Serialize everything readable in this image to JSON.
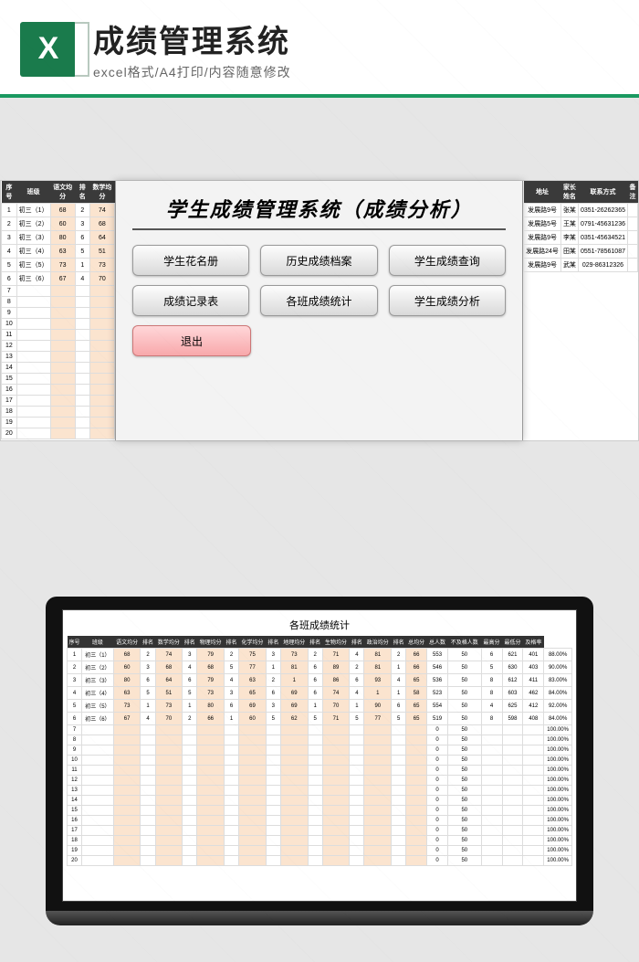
{
  "header": {
    "icon_letter": "X",
    "title": "成绩管理系统",
    "subtitle": "excel格式/A4打印/内容随意修改"
  },
  "panel": {
    "title": "学生成绩管理系统（成绩分析）",
    "buttons": [
      "学生花名册",
      "历史成绩档案",
      "学生成绩查询",
      "成绩记录表",
      "各班成绩统计",
      "学生成绩分析"
    ],
    "exit": "退出"
  },
  "left_grid": {
    "headers": [
      "序号",
      "班级",
      "语文均分",
      "排名",
      "数学均分"
    ],
    "rows": [
      [
        "1",
        "初三（1）",
        "68",
        "2",
        "74"
      ],
      [
        "2",
        "初三（2）",
        "60",
        "3",
        "68"
      ],
      [
        "3",
        "初三（3）",
        "80",
        "6",
        "64"
      ],
      [
        "4",
        "初三（4）",
        "63",
        "5",
        "51"
      ],
      [
        "5",
        "初三（5）",
        "73",
        "1",
        "73"
      ],
      [
        "6",
        "初三（6）",
        "67",
        "4",
        "70"
      ],
      [
        "7",
        "",
        "",
        "",
        ""
      ],
      [
        "8",
        "",
        "",
        "",
        ""
      ],
      [
        "9",
        "",
        "",
        "",
        ""
      ],
      [
        "10",
        "",
        "",
        "",
        ""
      ],
      [
        "11",
        "",
        "",
        "",
        ""
      ],
      [
        "12",
        "",
        "",
        "",
        ""
      ],
      [
        "13",
        "",
        "",
        "",
        ""
      ],
      [
        "14",
        "",
        "",
        "",
        ""
      ],
      [
        "15",
        "",
        "",
        "",
        ""
      ],
      [
        "16",
        "",
        "",
        "",
        ""
      ],
      [
        "17",
        "",
        "",
        "",
        ""
      ],
      [
        "18",
        "",
        "",
        "",
        ""
      ],
      [
        "19",
        "",
        "",
        "",
        ""
      ],
      [
        "20",
        "",
        "",
        "",
        ""
      ]
    ]
  },
  "right_grid": {
    "headers": [
      "地址",
      "家长姓名",
      "联系方式",
      "备注"
    ],
    "rows": [
      [
        "发展路9号",
        "张某",
        "0351-26262365",
        ""
      ],
      [
        "发展路5号",
        "王某",
        "0791-45631236",
        ""
      ],
      [
        "发展路9号",
        "李某",
        "0351-45634521",
        ""
      ],
      [
        "发展路24号",
        "田某",
        "0551-78561087",
        ""
      ],
      [
        "发展路9号",
        "武某",
        "029-86312326",
        ""
      ]
    ]
  },
  "laptop": {
    "sheet_title": "各班成绩统计",
    "headers": [
      "序号",
      "班级",
      "语文均分",
      "排名",
      "数学均分",
      "排名",
      "物理均分",
      "排名",
      "化学均分",
      "排名",
      "地理均分",
      "排名",
      "生物均分",
      "排名",
      "政治均分",
      "排名",
      "总均分",
      "总人数",
      "不及格人数",
      "最高分",
      "最低分",
      "及格率"
    ],
    "rows": [
      [
        "1",
        "初三（1）",
        "68",
        "2",
        "74",
        "3",
        "79",
        "2",
        "75",
        "3",
        "73",
        "2",
        "71",
        "4",
        "81",
        "2",
        "66",
        "553",
        "50",
        "6",
        "621",
        "401",
        "88.00%"
      ],
      [
        "2",
        "初三（2）",
        "60",
        "3",
        "68",
        "4",
        "68",
        "5",
        "77",
        "1",
        "81",
        "6",
        "89",
        "2",
        "81",
        "1",
        "66",
        "546",
        "50",
        "5",
        "630",
        "403",
        "90.00%"
      ],
      [
        "3",
        "初三（3）",
        "80",
        "6",
        "64",
        "6",
        "79",
        "4",
        "63",
        "2",
        "1",
        "6",
        "86",
        "6",
        "93",
        "4",
        "65",
        "536",
        "50",
        "8",
        "612",
        "411",
        "83.00%"
      ],
      [
        "4",
        "初三（4）",
        "63",
        "5",
        "51",
        "5",
        "73",
        "3",
        "65",
        "6",
        "69",
        "6",
        "74",
        "4",
        "1",
        "1",
        "58",
        "523",
        "50",
        "8",
        "603",
        "462",
        "84.00%"
      ],
      [
        "5",
        "初三（5）",
        "73",
        "1",
        "73",
        "1",
        "80",
        "6",
        "69",
        "3",
        "69",
        "1",
        "70",
        "1",
        "90",
        "6",
        "65",
        "554",
        "50",
        "4",
        "625",
        "412",
        "92.00%"
      ],
      [
        "6",
        "初三（6）",
        "67",
        "4",
        "70",
        "2",
        "66",
        "1",
        "60",
        "5",
        "62",
        "5",
        "71",
        "5",
        "77",
        "5",
        "65",
        "519",
        "50",
        "8",
        "598",
        "408",
        "84.00%"
      ],
      [
        "7",
        "",
        "",
        "",
        "",
        "",
        "",
        "",
        "",
        "",
        "",
        "",
        "",
        "",
        "",
        "",
        "",
        "0",
        "50",
        "",
        "",
        "",
        "100.00%"
      ],
      [
        "8",
        "",
        "",
        "",
        "",
        "",
        "",
        "",
        "",
        "",
        "",
        "",
        "",
        "",
        "",
        "",
        "",
        "0",
        "50",
        "",
        "",
        "",
        "100.00%"
      ],
      [
        "9",
        "",
        "",
        "",
        "",
        "",
        "",
        "",
        "",
        "",
        "",
        "",
        "",
        "",
        "",
        "",
        "",
        "0",
        "50",
        "",
        "",
        "",
        "100.00%"
      ],
      [
        "10",
        "",
        "",
        "",
        "",
        "",
        "",
        "",
        "",
        "",
        "",
        "",
        "",
        "",
        "",
        "",
        "",
        "0",
        "50",
        "",
        "",
        "",
        "100.00%"
      ],
      [
        "11",
        "",
        "",
        "",
        "",
        "",
        "",
        "",
        "",
        "",
        "",
        "",
        "",
        "",
        "",
        "",
        "",
        "0",
        "50",
        "",
        "",
        "",
        "100.00%"
      ],
      [
        "12",
        "",
        "",
        "",
        "",
        "",
        "",
        "",
        "",
        "",
        "",
        "",
        "",
        "",
        "",
        "",
        "",
        "0",
        "50",
        "",
        "",
        "",
        "100.00%"
      ],
      [
        "13",
        "",
        "",
        "",
        "",
        "",
        "",
        "",
        "",
        "",
        "",
        "",
        "",
        "",
        "",
        "",
        "",
        "0",
        "50",
        "",
        "",
        "",
        "100.00%"
      ],
      [
        "14",
        "",
        "",
        "",
        "",
        "",
        "",
        "",
        "",
        "",
        "",
        "",
        "",
        "",
        "",
        "",
        "",
        "0",
        "50",
        "",
        "",
        "",
        "100.00%"
      ],
      [
        "15",
        "",
        "",
        "",
        "",
        "",
        "",
        "",
        "",
        "",
        "",
        "",
        "",
        "",
        "",
        "",
        "",
        "0",
        "50",
        "",
        "",
        "",
        "100.00%"
      ],
      [
        "16",
        "",
        "",
        "",
        "",
        "",
        "",
        "",
        "",
        "",
        "",
        "",
        "",
        "",
        "",
        "",
        "",
        "0",
        "50",
        "",
        "",
        "",
        "100.00%"
      ],
      [
        "17",
        "",
        "",
        "",
        "",
        "",
        "",
        "",
        "",
        "",
        "",
        "",
        "",
        "",
        "",
        "",
        "",
        "0",
        "50",
        "",
        "",
        "",
        "100.00%"
      ],
      [
        "18",
        "",
        "",
        "",
        "",
        "",
        "",
        "",
        "",
        "",
        "",
        "",
        "",
        "",
        "",
        "",
        "",
        "0",
        "50",
        "",
        "",
        "",
        "100.00%"
      ],
      [
        "19",
        "",
        "",
        "",
        "",
        "",
        "",
        "",
        "",
        "",
        "",
        "",
        "",
        "",
        "",
        "",
        "",
        "0",
        "50",
        "",
        "",
        "",
        "100.00%"
      ],
      [
        "20",
        "",
        "",
        "",
        "",
        "",
        "",
        "",
        "",
        "",
        "",
        "",
        "",
        "",
        "",
        "",
        "",
        "0",
        "50",
        "",
        "",
        "",
        "100.00%"
      ]
    ]
  }
}
